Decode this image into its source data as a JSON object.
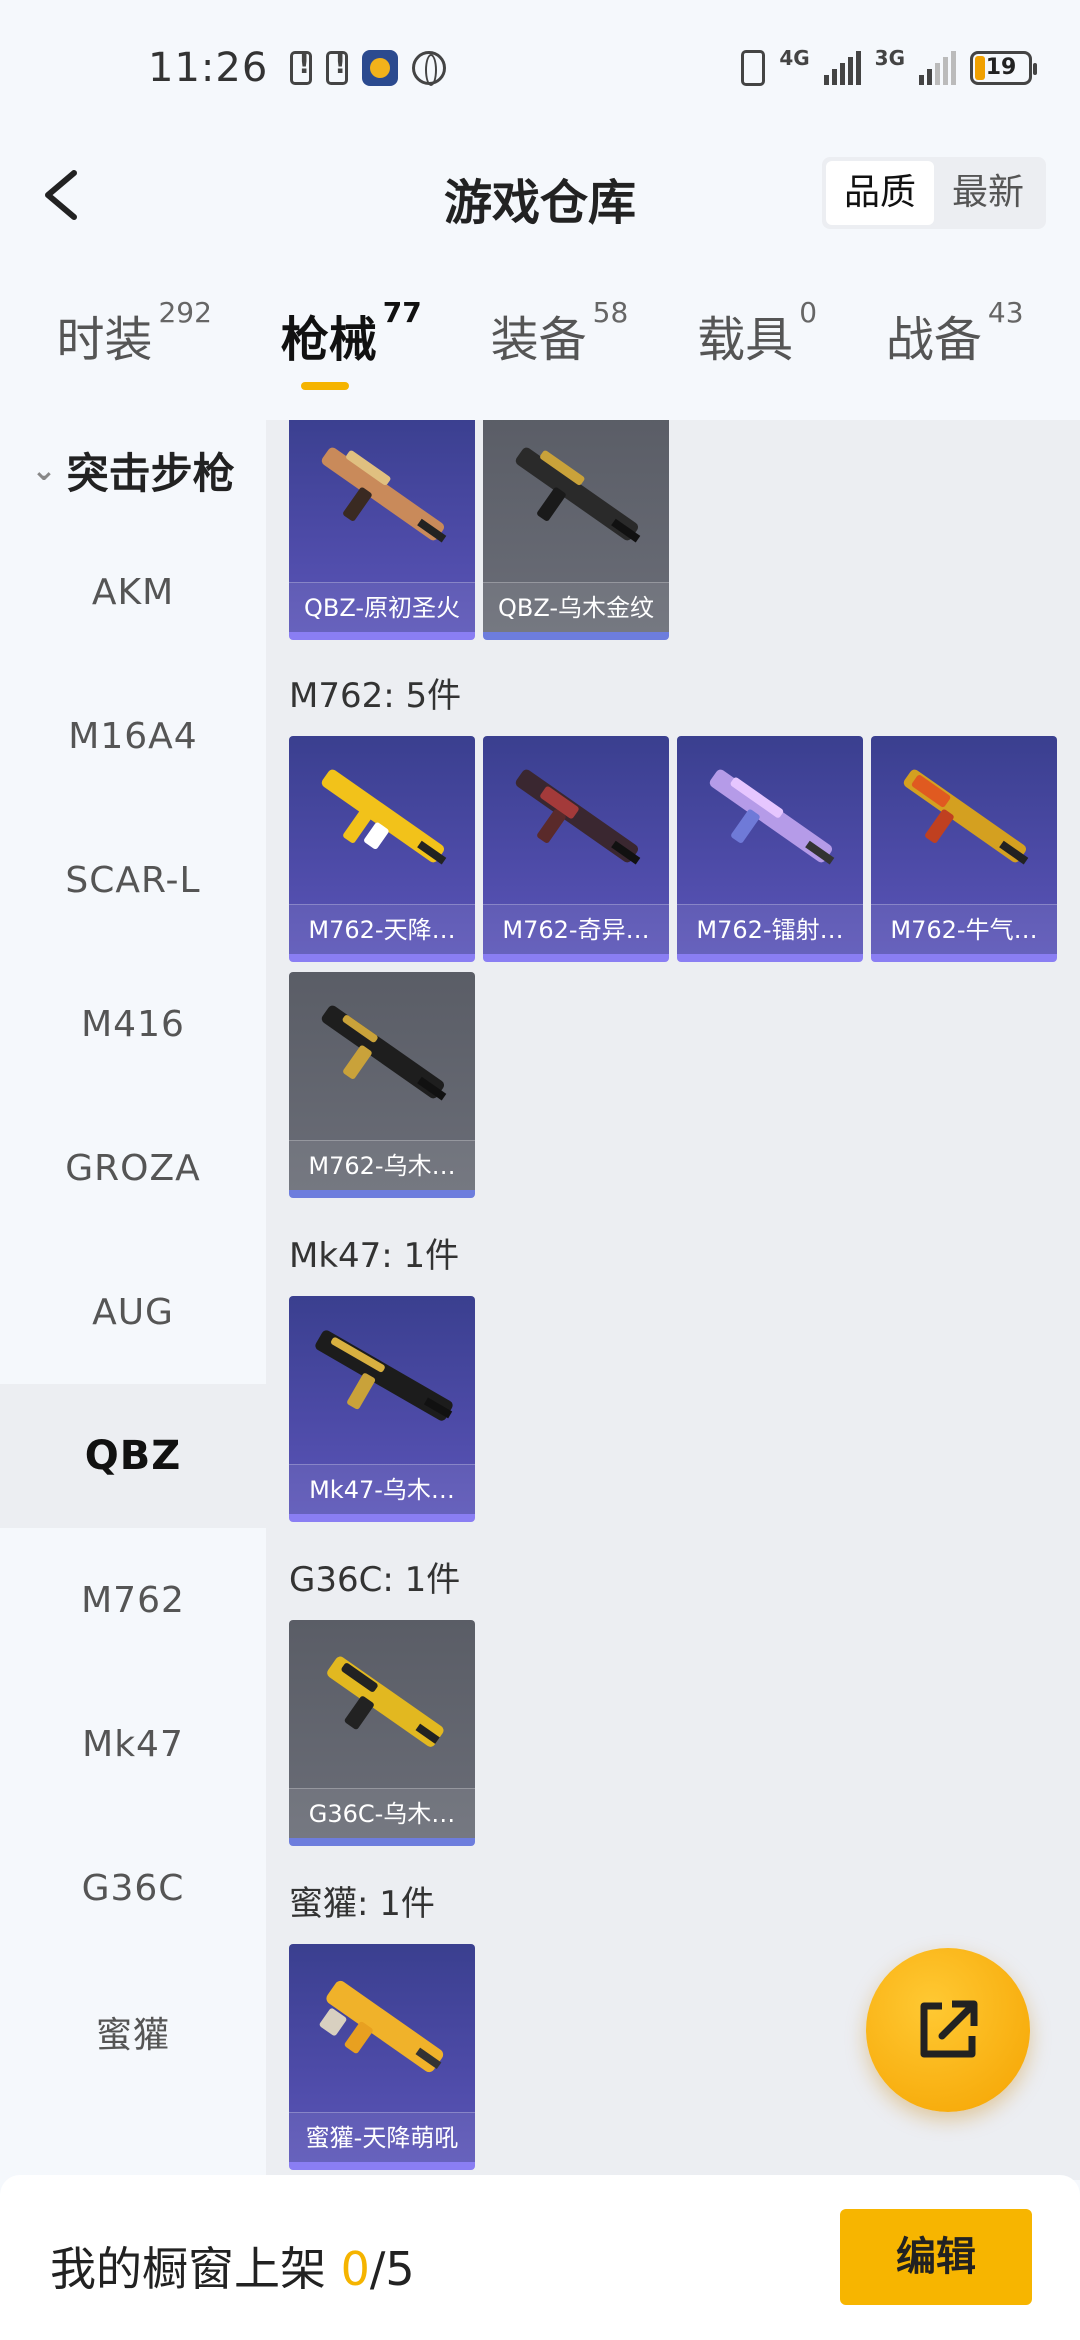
{
  "status_bar": {
    "time": "11:26",
    "net1": "4G",
    "net2": "3G",
    "battery": "19"
  },
  "header": {
    "title": "游戏仓库",
    "sort_options": [
      "品质",
      "最新"
    ]
  },
  "tabs": [
    {
      "label": "时装",
      "count": "292"
    },
    {
      "label": "枪械",
      "count": "77"
    },
    {
      "label": "装备",
      "count": "58"
    },
    {
      "label": "载具",
      "count": "0"
    },
    {
      "label": "战备",
      "count": "43"
    }
  ],
  "sidebar": {
    "category": "突击步枪",
    "items": [
      "AKM",
      "M16A4",
      "SCAR-L",
      "M416",
      "GROZA",
      "AUG",
      "QBZ",
      "M762",
      "Mk47",
      "G36C",
      "蜜獾"
    ],
    "selected": "QBZ"
  },
  "groups": {
    "qbz": {
      "items": [
        "QBZ-原初圣火",
        "QBZ-乌木金纹"
      ]
    },
    "m762": {
      "label": "M762: 5件",
      "items": [
        "M762-天降…",
        "M762-奇异…",
        "M762-镭射…",
        "M762-牛气…",
        "M762-乌木…"
      ]
    },
    "mk47": {
      "label": "Mk47: 1件",
      "items": [
        "Mk47-乌木…"
      ]
    },
    "g36c": {
      "label": "G36C: 1件",
      "items": [
        "G36C-乌木…"
      ]
    },
    "honeybadger": {
      "label": "蜜獾: 1件",
      "items": [
        "蜜獾-天降萌吼"
      ]
    }
  },
  "bottom_bar": {
    "label": "我的橱窗上架",
    "count": "0",
    "total": "/5",
    "edit": "编辑"
  },
  "colors": {
    "accent": "#f5b400",
    "card_purple": "#4c4aa6",
    "card_gray": "#5f626b"
  }
}
